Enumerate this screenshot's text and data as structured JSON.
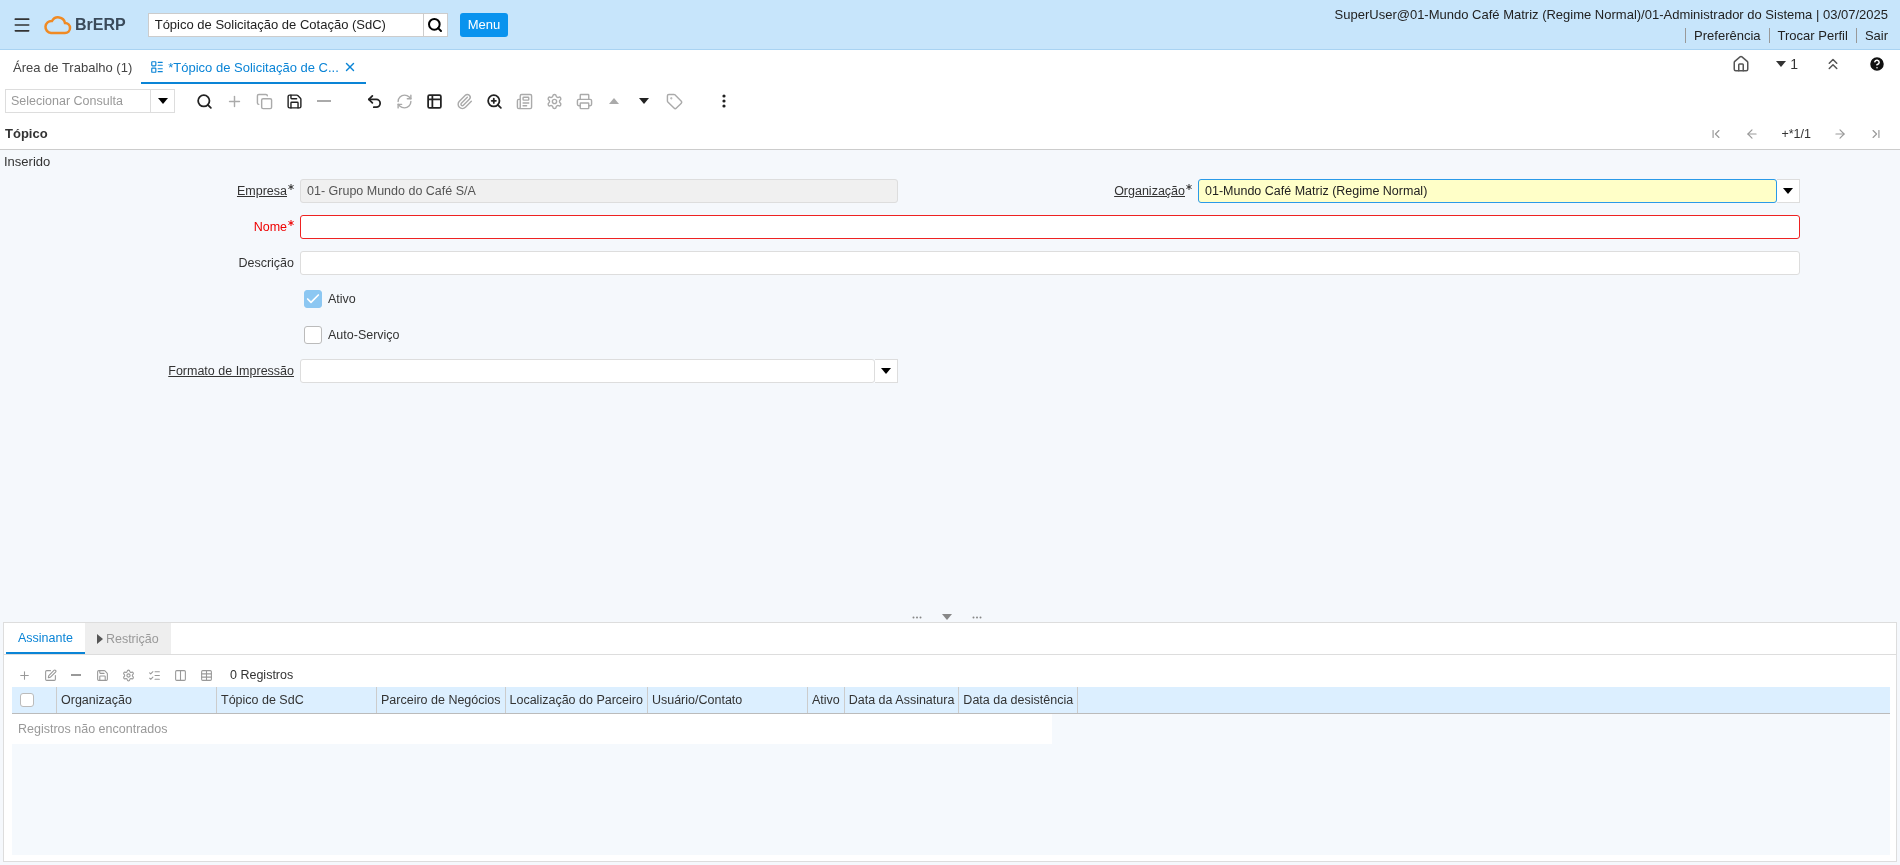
{
  "header": {
    "logo_text": "BrERP",
    "search_value": "Tópico de Solicitação de Cotação (SdC)",
    "menu_button": "Menu",
    "user_info": "SuperUser@01-Mundo Café Matriz (Regime Normal)/01-Administrador do Sistema | 03/07/2025",
    "links": [
      "Preferência",
      "Trocar Perfil",
      "Sair"
    ]
  },
  "window_tabs": [
    {
      "kind": "home",
      "label": "Área de Trabalho (1)",
      "selected": false
    },
    {
      "kind": "window",
      "label": "*Tópico de Solicitação de C...",
      "selected": true
    }
  ],
  "query": {
    "placeholder": "Selecionar Consulta"
  },
  "toolbar": [
    {
      "kind": "search",
      "disabled": false
    },
    {
      "kind": "new",
      "disabled": true
    },
    {
      "kind": "copy",
      "disabled": true
    },
    {
      "kind": "save",
      "disabled": false
    },
    {
      "kind": "delete",
      "disabled": true
    },
    {
      "kind": "undo",
      "disabled": false
    },
    {
      "kind": "refresh",
      "disabled": true
    },
    {
      "kind": "grid",
      "disabled": false
    },
    {
      "kind": "attach",
      "disabled": true
    },
    {
      "kind": "zoom",
      "disabled": false
    },
    {
      "kind": "report",
      "disabled": true
    },
    {
      "kind": "process",
      "disabled": true
    },
    {
      "kind": "print",
      "disabled": true
    },
    {
      "kind": "up",
      "disabled": true
    },
    {
      "kind": "down",
      "disabled": false
    },
    {
      "kind": "tag",
      "disabled": true
    },
    {
      "kind": "more",
      "disabled": false
    }
  ],
  "top_right": {
    "counter": "1"
  },
  "panel": {
    "title": "Tópico",
    "record_nav": "+*1/1",
    "status": "Inserido"
  },
  "form_rows": [
    [
      {
        "kind": "text",
        "label": "Empresa",
        "value": "01- Grupo Mundo do Café S/A",
        "required": true,
        "readonly": true,
        "invalid": false,
        "focused": false
      },
      {
        "kind": "select",
        "label": "Organização",
        "value": "01-Mundo Café Matriz (Regime Normal)",
        "required": true,
        "readonly": false,
        "invalid": false,
        "focused": true
      }
    ],
    [
      {
        "kind": "wide",
        "label": "Nome",
        "required": true,
        "readonly": false,
        "invalid": true,
        "focused": false
      }
    ],
    [
      {
        "kind": "wide",
        "label": "Descrição",
        "required": false,
        "readonly": false,
        "invalid": false,
        "focused": false
      }
    ],
    [
      {
        "kind": "checkbox",
        "label": "Ativo",
        "checked": true
      }
    ],
    [
      {
        "kind": "checkbox",
        "label": "Auto-Serviço",
        "checked": false
      }
    ],
    [
      {
        "kind": "select",
        "label": "Formato de Impressão",
        "required": false,
        "readonly": false,
        "invalid": false,
        "focused": false
      }
    ]
  ],
  "detail_tabs": [
    {
      "label": "Assinante",
      "selected": true
    },
    {
      "label": "Restrição",
      "selected": false
    }
  ],
  "grid": {
    "toolbar": [
      {
        "kind": "new"
      },
      {
        "kind": "edit"
      },
      {
        "kind": "delete"
      },
      {
        "kind": "save"
      },
      {
        "kind": "process"
      },
      {
        "kind": "checklist"
      },
      {
        "kind": "columns"
      },
      {
        "kind": "table"
      }
    ],
    "count": "0 Registros",
    "select_all": {
      "checked": false
    },
    "columns": [
      "Organização",
      "Tópico de SdC",
      "Parceiro de Negócios",
      "Localização do Parceiro",
      "Usuário/Contato",
      "Ativo",
      "Data da Assinatura",
      "Data da desistência"
    ],
    "empty_message": "Registros não encontrados"
  }
}
